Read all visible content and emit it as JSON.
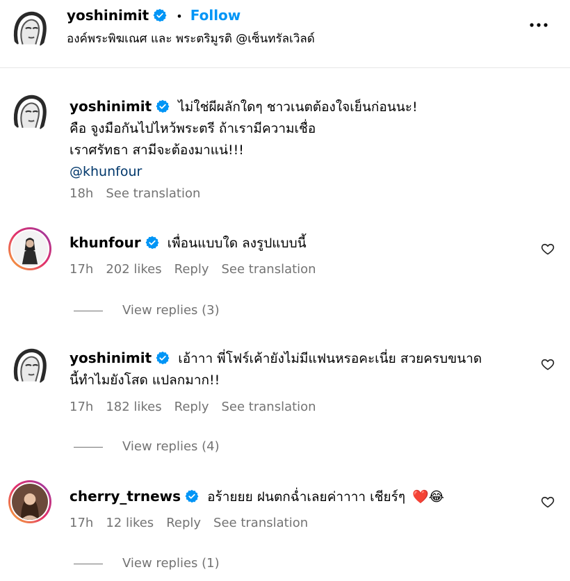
{
  "post": {
    "username": "yoshinimit",
    "dot": "•",
    "follow_label": "Follow",
    "location": "องค์พระพิฆเณศ และ พระตริมูรติ @เซ็นทรัลเวิลด์",
    "more_icon": "more-horizontal-icon"
  },
  "caption": {
    "username": "yoshinimit",
    "lines": [
      "ไม่ใช่ผีผลักใดๆ ชาวเนตต้องใจเย็นก่อนนะ!",
      "คือ จูงมือกันไปไหว้พระตรี ถ้าเรามีความเชื่อ",
      "เราศรัทธา สามีจะต้องมาแน่!!!"
    ],
    "mention": "@khunfour",
    "time": "18h",
    "translate": "See translation"
  },
  "comments": [
    {
      "username": "khunfour",
      "text": "เพื่อนแบบใด ลงรูปแบบนี้",
      "time": "17h",
      "likes": "202 likes",
      "reply": "Reply",
      "translate": "See translation",
      "view_replies": "View replies (3)"
    },
    {
      "username": "yoshinimit",
      "text_line1": "เอ้าาา พี่โฟร์เค้ายังไม่มีแฟนหรอคะเนี่ย สวยครบขนาด",
      "text_line2": "นี้ทำไมยังโสด แปลกมาก!!",
      "time": "17h",
      "likes": "182 likes",
      "reply": "Reply",
      "translate": "See translation",
      "view_replies": "View replies (4)"
    },
    {
      "username": "cherry_trnews",
      "text": "อร้ายยย ฝนตกฉ่ำเลยค่าาาา เชียร์ๆ",
      "emoji": "❤️😂",
      "time": "17h",
      "likes": "12 likes",
      "reply": "Reply",
      "translate": "See translation",
      "view_replies": "View replies (1)"
    }
  ],
  "colors": {
    "link": "#0095f6",
    "mention": "#00376b",
    "meta": "#737373",
    "verified": "#0095f6"
  }
}
